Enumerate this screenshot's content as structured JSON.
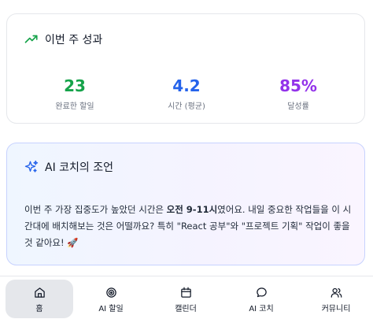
{
  "performance": {
    "title": "이번 주 성과",
    "stats": [
      {
        "value": "23",
        "label": "완료한 할일",
        "color": "#16a34a"
      },
      {
        "value": "4.2",
        "label": "시간 (평균)",
        "color": "#2563eb"
      },
      {
        "value": "85%",
        "label": "달성률",
        "color": "#9333ea"
      }
    ]
  },
  "coach": {
    "title": "AI 코치의 조언",
    "message_part1": "이번 주 가장 집중도가 높았던 시간은 ",
    "message_bold": "오전 9-11시",
    "message_part2": "였어요. 내일 중요한 작업들을 이 시간대에 배치해보는 것은 어떨까요? 특히 \"React 공부\"와 \"프로젝트 기획\" 작업이 좋을 것 같아요! 🚀"
  },
  "nav": {
    "items": [
      {
        "label": "홈",
        "icon": "home-icon",
        "active": true
      },
      {
        "label": "AI 할일",
        "icon": "target-icon"
      },
      {
        "label": "캘린더",
        "icon": "calendar-icon"
      },
      {
        "label": "AI 코치",
        "icon": "chat-bubble-icon"
      },
      {
        "label": "커뮤니티",
        "icon": "users-icon"
      }
    ]
  }
}
